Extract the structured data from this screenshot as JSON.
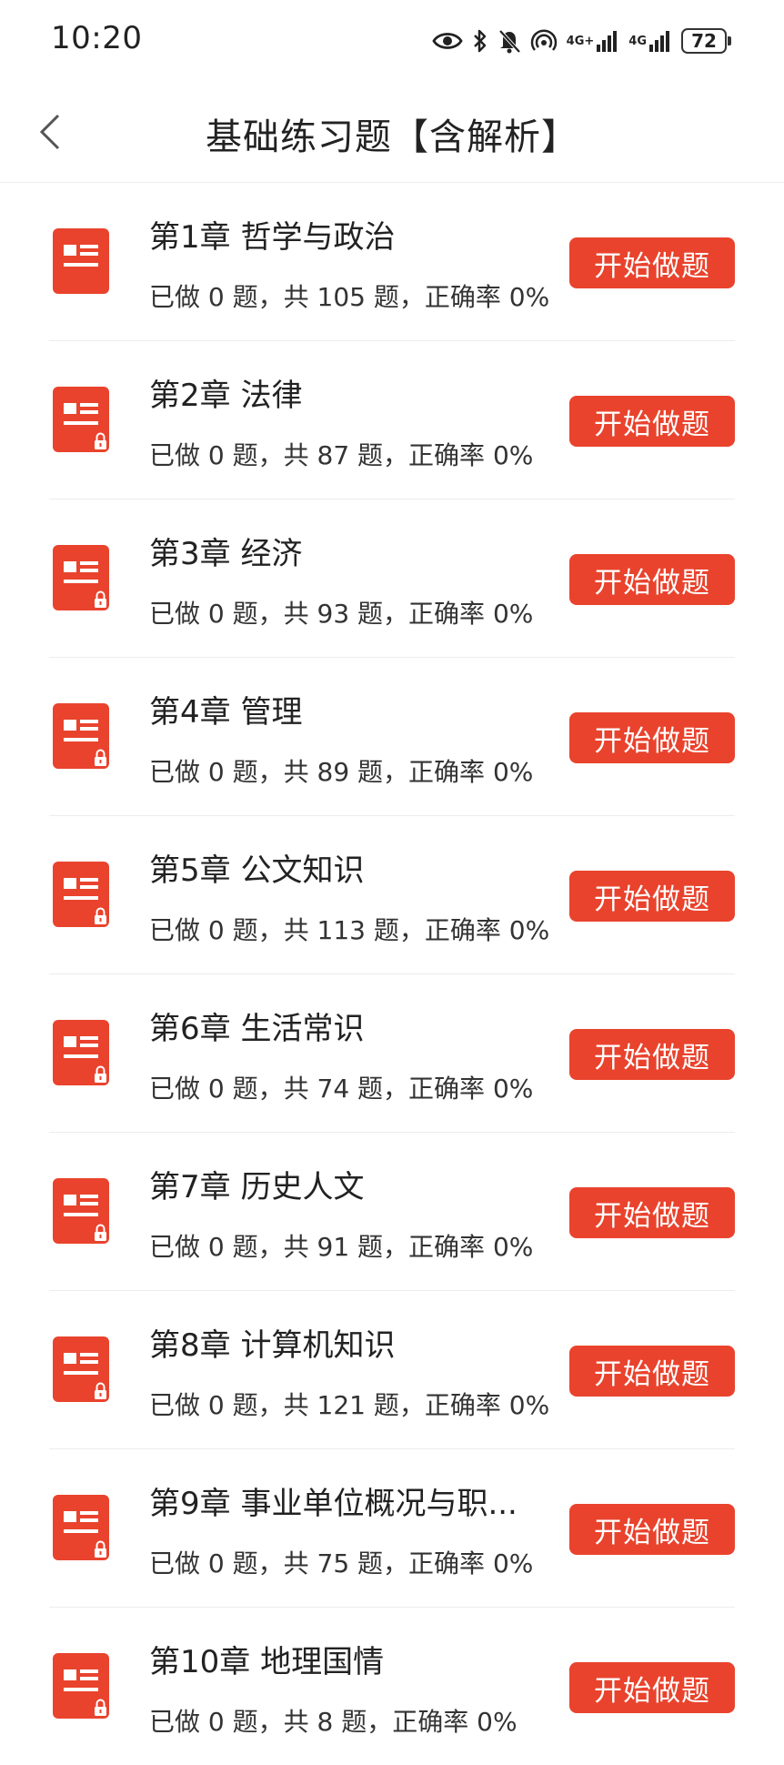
{
  "status_bar": {
    "time": "10:20",
    "sim1_label": "4G+",
    "sim2_label": "4G",
    "battery": "72",
    "icons": [
      "eye-icon",
      "bluetooth-icon",
      "bell-muted-icon",
      "hotspot-icon",
      "signal-icon",
      "signal-icon",
      "battery-icon"
    ]
  },
  "header": {
    "title": "基础练习题【含解析】",
    "back_icon": "chevron-left-icon"
  },
  "colors": {
    "accent": "#e9432d",
    "icon_red": "#e9432d"
  },
  "chapters": [
    {
      "title": "第1章 哲学与政治",
      "subtitle": "已做 0 题，共 105 题，正确率 0%",
      "button": "开始做题",
      "locked": false
    },
    {
      "title": "第2章 法律",
      "subtitle": "已做 0 题，共 87 题，正确率 0%",
      "button": "开始做题",
      "locked": true
    },
    {
      "title": "第3章 经济",
      "subtitle": "已做 0 题，共 93 题，正确率 0%",
      "button": "开始做题",
      "locked": true
    },
    {
      "title": "第4章 管理",
      "subtitle": "已做 0 题，共 89 题，正确率 0%",
      "button": "开始做题",
      "locked": true
    },
    {
      "title": "第5章 公文知识",
      "subtitle": "已做 0 题，共 113 题，正确率 0%",
      "button": "开始做题",
      "locked": true
    },
    {
      "title": "第6章 生活常识",
      "subtitle": "已做 0 题，共 74 题，正确率 0%",
      "button": "开始做题",
      "locked": true
    },
    {
      "title": "第7章 历史人文",
      "subtitle": "已做 0 题，共 91 题，正确率 0%",
      "button": "开始做题",
      "locked": true
    },
    {
      "title": "第8章 计算机知识",
      "subtitle": "已做 0 题，共 121 题，正确率 0%",
      "button": "开始做题",
      "locked": true
    },
    {
      "title": "第9章 事业单位概况与职...",
      "subtitle": "已做 0 题，共 75 题，正确率 0%",
      "button": "开始做题",
      "locked": true
    },
    {
      "title": "第10章 地理国情",
      "subtitle": "已做 0 题，共 8 题，正确率 0%",
      "button": "开始做题",
      "locked": true
    }
  ]
}
